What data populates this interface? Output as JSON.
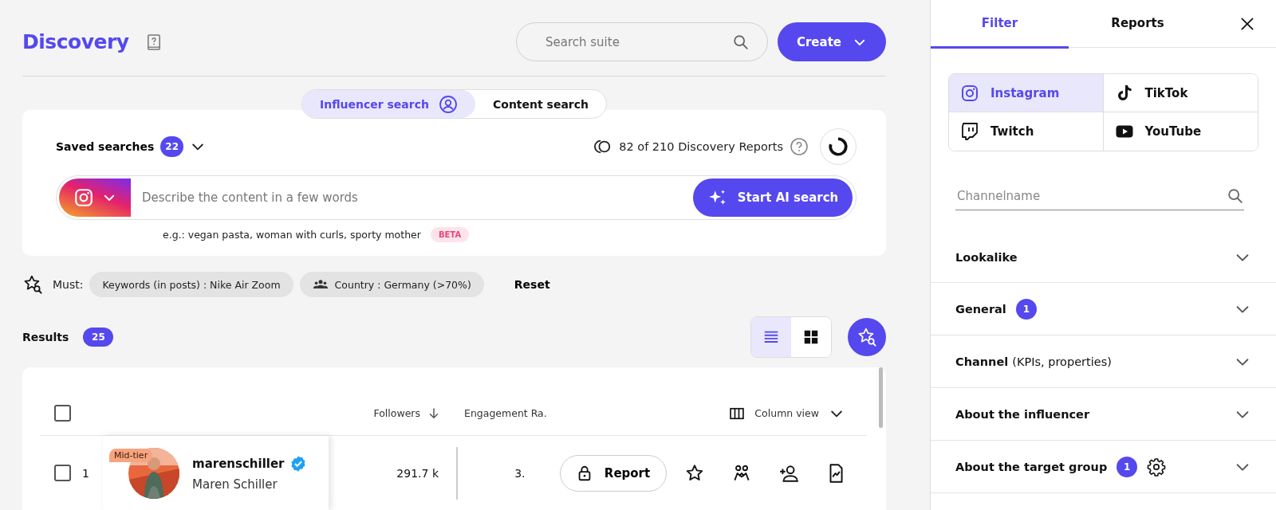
{
  "header": {
    "title": "Discovery",
    "search": {
      "placeholder": "Search suite"
    },
    "create_button": "Create"
  },
  "search_modes": [
    {
      "label": "Influencer search",
      "selected": true
    },
    {
      "label": "Content search",
      "selected": false
    }
  ],
  "saved_searches": {
    "label": "Saved searches",
    "count": "22"
  },
  "reports_quota": "82 of 210 Discovery Reports",
  "ai_search": {
    "placeholder": "Describe the content in a few words",
    "button": "Start AI search",
    "hint": "e.g.: vegan pasta, woman with curls, sporty mother",
    "badge": "BETA"
  },
  "filters": {
    "label": "Must:",
    "chips": [
      {
        "kind": "plain",
        "label": "Keywords (in posts) : Nike Air Zoom"
      },
      {
        "kind": "audience",
        "label": "Country : Germany (>70%)"
      }
    ],
    "reset": "Reset"
  },
  "results": {
    "label": "Results",
    "count": "25",
    "views": [
      {
        "kind": "list",
        "selected": true
      },
      {
        "kind": "grid",
        "selected": false
      }
    ]
  },
  "table": {
    "select_all_checked": false,
    "columns": [
      "Followers",
      "Engagement Ra."
    ],
    "column_view": "Column view",
    "rows": [
      {
        "checked": false,
        "index": "1",
        "tier": "Mid-tier",
        "handle": "marenschiller",
        "verified": true,
        "name": "Maren Schiller",
        "followers": "291.7 k",
        "engagement": "3.",
        "report": "Report"
      }
    ]
  },
  "panel": {
    "tabs": [
      {
        "label": "Filter",
        "selected": true
      },
      {
        "label": "Reports",
        "selected": false
      }
    ],
    "platforms": [
      {
        "kind": "instagram",
        "label": "Instagram",
        "selected": true
      },
      {
        "kind": "tiktok",
        "label": "TikTok",
        "selected": false
      },
      {
        "kind": "twitch",
        "label": "Twitch",
        "selected": false
      },
      {
        "kind": "youtube",
        "label": "YouTube",
        "selected": false
      }
    ],
    "channel_search": {
      "placeholder": "Channelname"
    },
    "sections": [
      {
        "title": "Lookalike"
      },
      {
        "title": "General",
        "count": "1"
      },
      {
        "title": "Channel",
        "note": "(KPIs, properties)"
      },
      {
        "title": "About the influencer"
      },
      {
        "title": "About the target group",
        "count": "1",
        "settings": true
      }
    ]
  }
}
